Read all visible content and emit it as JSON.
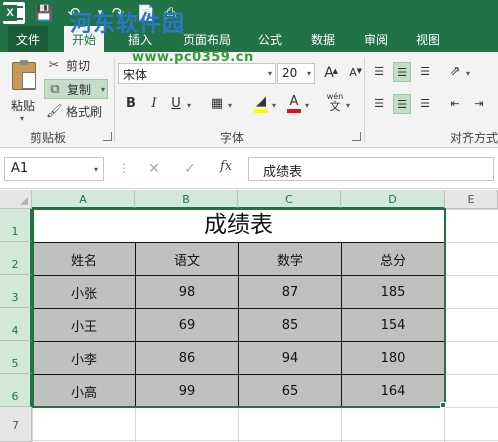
{
  "titlebar": {
    "watermark": "河东软件园",
    "watermark_url": "www.pc0359.cn"
  },
  "tabs": [
    "文件",
    "开始",
    "插入",
    "页面布局",
    "公式",
    "数据",
    "审阅",
    "视图"
  ],
  "clipboard": {
    "paste_label": "粘贴",
    "cut_label": "剪切",
    "copy_label": "复制",
    "format_painter_label": "格式刷",
    "group_label": "剪贴板"
  },
  "font": {
    "name": "宋体",
    "size": "20",
    "group_label": "字体",
    "bold": "B",
    "italic": "I",
    "underline": "U",
    "phonetic": "wén",
    "grow": "A",
    "shrink": "A",
    "text_color": "A",
    "highlight_color": "#ffff00",
    "font_color": "#e0121a"
  },
  "alignment": {
    "group_label": "对齐方式"
  },
  "formula_bar": {
    "name_box": "A1",
    "fx": "fx",
    "content": "成绩表"
  },
  "sheet": {
    "columns": [
      "A",
      "B",
      "C",
      "D",
      "E"
    ],
    "rows": [
      "1",
      "2",
      "3",
      "4",
      "5",
      "6",
      "7"
    ],
    "title": "成绩表",
    "headers": [
      "姓名",
      "语文",
      "数学",
      "总分"
    ],
    "data": [
      [
        "小张",
        "98",
        "87",
        "185"
      ],
      [
        "小王",
        "69",
        "85",
        "154"
      ],
      [
        "小李",
        "86",
        "94",
        "180"
      ],
      [
        "小高",
        "99",
        "65",
        "164"
      ]
    ]
  },
  "colors": {
    "accent": "#217346",
    "cell_fill": "#c0c0c0"
  }
}
